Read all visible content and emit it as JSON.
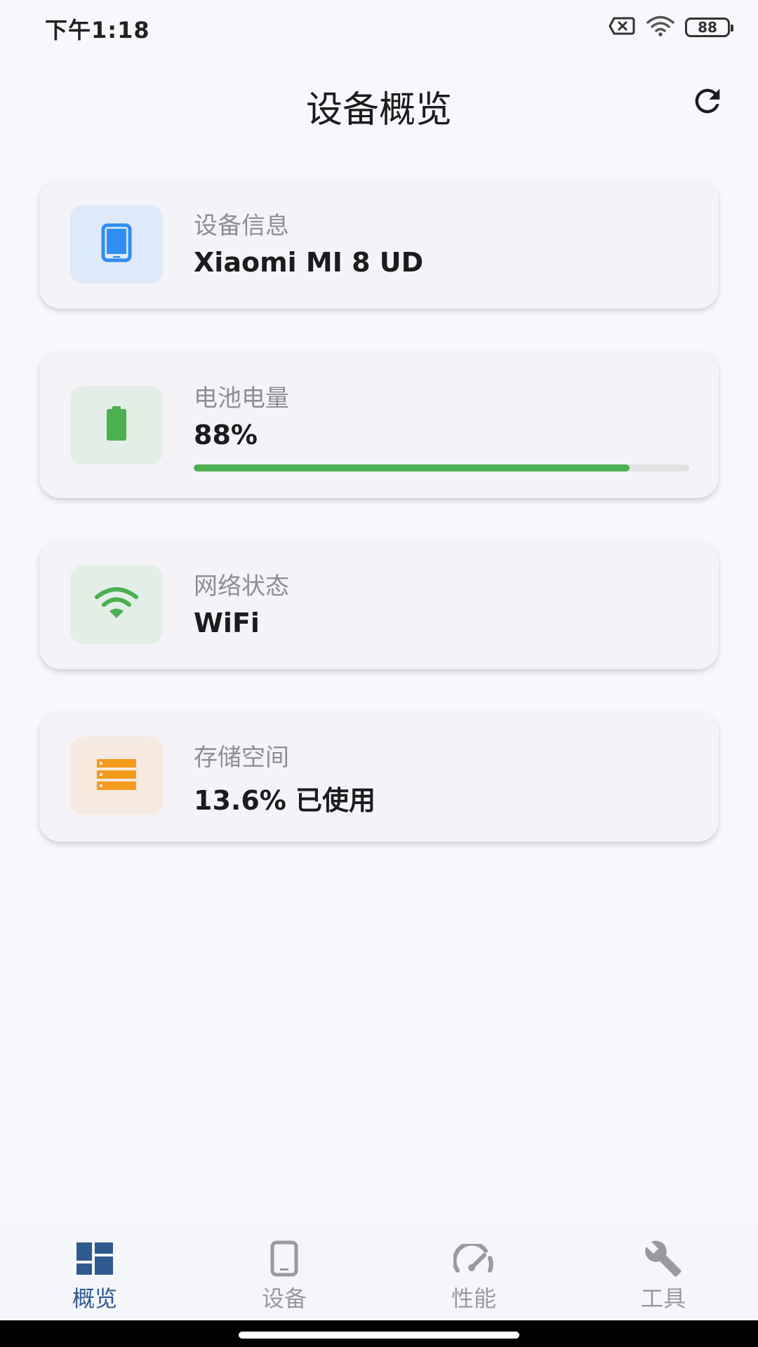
{
  "status_bar": {
    "time": "下午1:18",
    "battery_level": "88"
  },
  "header": {
    "title": "设备概览"
  },
  "cards": [
    {
      "label": "设备信息",
      "value": "Xiaomi MI 8 UD",
      "icon": "phone-icon",
      "icon_color": "#2f8ef0",
      "icon_bg": "#deeaf9"
    },
    {
      "label": "电池电量",
      "value": "88%",
      "progress": 0.88,
      "icon": "battery-icon",
      "icon_color": "#4caf50",
      "icon_bg": "#e3eee6"
    },
    {
      "label": "网络状态",
      "value": "WiFi",
      "icon": "wifi-icon",
      "icon_color": "#4caf50",
      "icon_bg": "#e3eee6"
    },
    {
      "label": "存储空间",
      "value": "13.6% 已使用",
      "icon": "storage-icon",
      "icon_color": "#f59b1c",
      "icon_bg": "#f6eae0"
    }
  ],
  "nav": {
    "active_color": "#2f5a8f",
    "inactive_color": "#9a9a9e",
    "items": [
      {
        "label": "概览",
        "icon": "dashboard-icon",
        "active": true
      },
      {
        "label": "设备",
        "icon": "device-icon",
        "active": false
      },
      {
        "label": "性能",
        "icon": "speedometer-icon",
        "active": false
      },
      {
        "label": "工具",
        "icon": "wrench-icon",
        "active": false
      }
    ]
  }
}
